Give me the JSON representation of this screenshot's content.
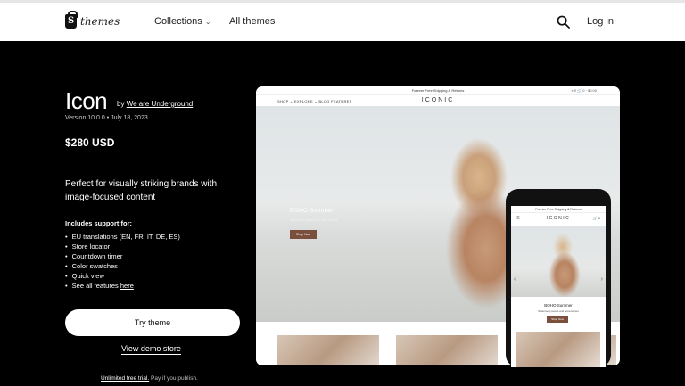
{
  "nav": {
    "logo_text": "themes",
    "collections": "Collections",
    "all_themes": "All themes",
    "login": "Log in"
  },
  "theme": {
    "name": "Icon",
    "by_prefix": "by",
    "author": "We are Underground",
    "version": "Version 10.0.0 • July 18, 2023",
    "price": "$280 USD",
    "tagline": "Perfect for visually striking brands with image-focused content",
    "supports_heading": "Includes support for:",
    "features": [
      "EU translations (EN, FR, IT, DE, ES)",
      "Store locator",
      "Countdown timer",
      "Color swatches",
      "Quick view"
    ],
    "see_all_prefix": "See all features",
    "see_all_link": "here"
  },
  "actions": {
    "try_theme": "Try theme",
    "view_demo": "View demo store",
    "trial_link": "Unlimited free trial.",
    "trial_rest": " Pay if you publish."
  },
  "preview": {
    "banner": "Forever Free Shipping & Returns",
    "header_right": "⌕  ⚲   🛒 0 · $0.00",
    "menu": "SHOP ⌄   EXPLORE ⌄   BLOG   FEATURES",
    "brand": "ICONIC",
    "hero_title": "BOHO Summer",
    "hero_sub": "Statement pieces and accessories",
    "hero_button": "Shop Now",
    "mobile_banner": "Forever Free Shipping & Returns",
    "mobile_brand": "ICONIC",
    "mobile_cart": "🛒 0",
    "mobile_title": "BOHO Summer",
    "mobile_sub": "Statement pieces and accessories",
    "mobile_button": "Shop Now"
  },
  "colors": {
    "hero_button": "#7a4f3c",
    "background": "#000000"
  }
}
